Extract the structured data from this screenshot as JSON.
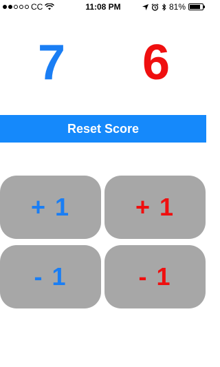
{
  "status_bar": {
    "signal_dots": [
      true,
      true,
      false,
      false,
      false
    ],
    "carrier": "CC",
    "wifi_icon": "wifi-icon",
    "time": "11:08 PM",
    "location_icon": "location-arrow-icon",
    "alarm_icon": "alarm-icon",
    "bluetooth_icon": "bluetooth-icon",
    "battery_percent": "81%",
    "battery_level": 0.81
  },
  "scores": {
    "left": "7",
    "right": "6",
    "left_color": "#1a7ef4",
    "right_color": "#ef0f0f"
  },
  "reset_button": {
    "label": "Reset Score",
    "color": "#1589fb"
  },
  "controls": {
    "left_plus": "+ 1",
    "right_plus": "+ 1",
    "left_minus": "- 1",
    "right_minus": "- 1",
    "button_color": "#a7a7a7"
  }
}
